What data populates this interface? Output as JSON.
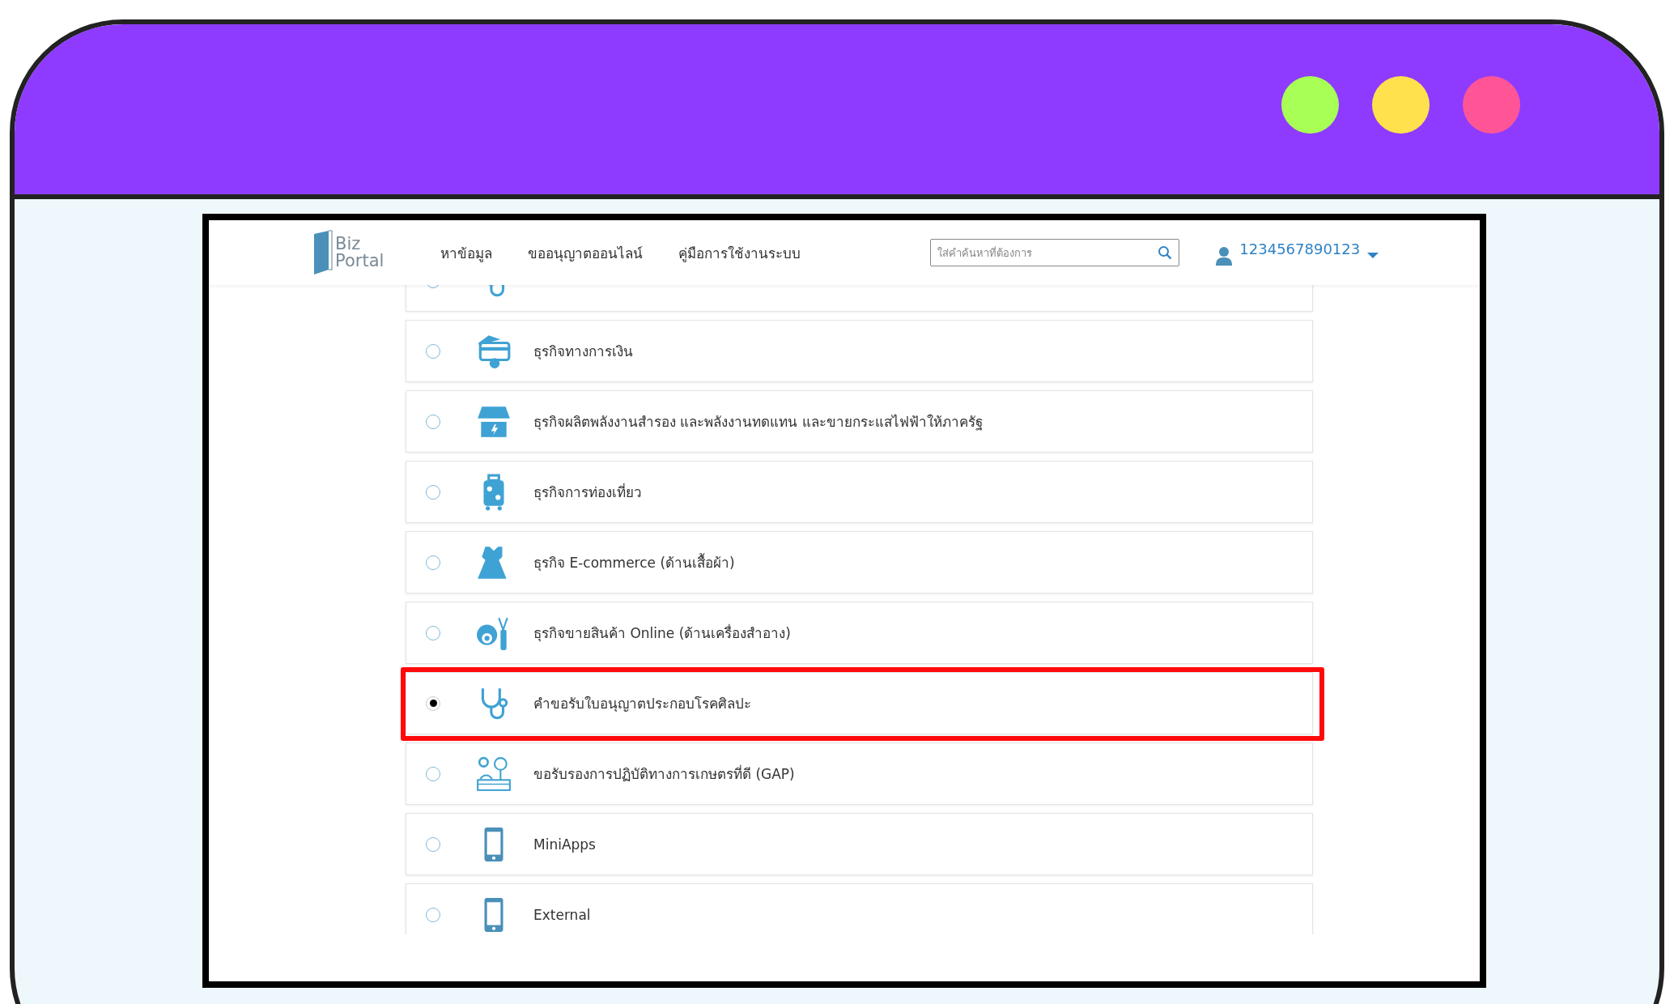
{
  "window": {
    "dots": [
      {
        "color": "#a8ff55"
      },
      {
        "color": "#ffe14d"
      },
      {
        "color": "#ff5596"
      }
    ]
  },
  "navbar": {
    "logo": {
      "line1": "Biz",
      "line2": "Portal"
    },
    "menu": [
      "หาข้อมูล",
      "ขออนุญาตออนไลน์",
      "คู่มือการใช้งานระบบ"
    ],
    "search": {
      "placeholder": "ใส่คำค้นหาที่ต้องการ"
    },
    "user": "1234567890123"
  },
  "options": [
    {
      "kind": "stethoscope",
      "selected": false
    },
    {
      "kind": "money",
      "label": "ธุรกิจทางการเงิน",
      "selected": false
    },
    {
      "kind": "solar",
      "label": "ธุรกิจผลิตพลังงานสำรอง และพลังงานทดแทน และขายกระแสไฟฟ้าให้ภาครัฐ",
      "selected": false
    },
    {
      "kind": "luggage",
      "label": "ธุรกิจการท่องเที่ยว",
      "selected": false
    },
    {
      "kind": "dress",
      "label": "ธุรกิจ E-commerce (ด้านเสื้อผ้า)",
      "selected": false
    },
    {
      "kind": "cosmetics",
      "label": "ธุรกิจขายสินค้า Online (ด้านเครื่องสำอาง)",
      "selected": false
    },
    {
      "kind": "stethoscope",
      "label": "คำขอรับใบอนุญาตประกอบโรคศิลปะ",
      "selected": true,
      "highlighted": true
    },
    {
      "kind": "farm",
      "label": "ขอรับรองการปฏิบัติทางการเกษตรที่ดี (GAP)",
      "selected": false
    },
    {
      "kind": "phone",
      "label": "MiniApps",
      "selected": false
    },
    {
      "kind": "phone",
      "label": "External",
      "selected": false
    }
  ]
}
